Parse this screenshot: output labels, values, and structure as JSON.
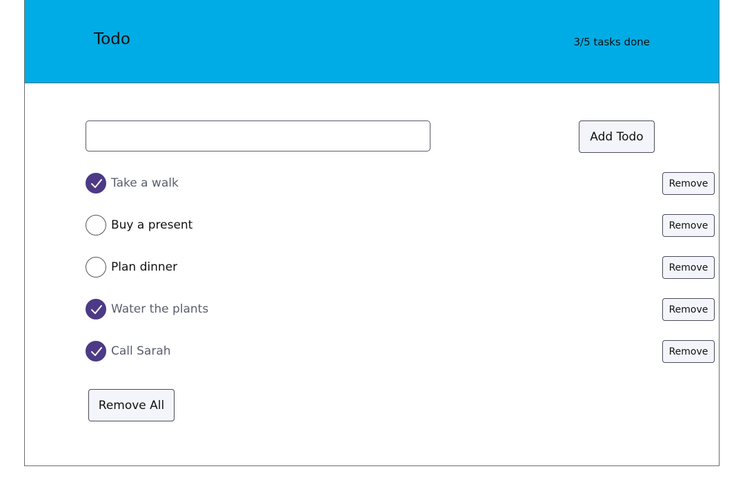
{
  "header": {
    "title": "Todo",
    "progress": "3/5 tasks done",
    "background": "#00ace6"
  },
  "form": {
    "input_value": "",
    "input_placeholder": "",
    "add_label": "Add Todo"
  },
  "todos": [
    {
      "text": "Take a walk",
      "done": true,
      "remove_label": "Remove"
    },
    {
      "text": "Buy a present",
      "done": false,
      "remove_label": "Remove"
    },
    {
      "text": "Plan dinner",
      "done": false,
      "remove_label": "Remove"
    },
    {
      "text": "Water the plants",
      "done": true,
      "remove_label": "Remove"
    },
    {
      "text": "Call Sarah",
      "done": true,
      "remove_label": "Remove"
    }
  ],
  "remove_all_label": "Remove All",
  "colors": {
    "check_done": "#4d3a86",
    "button_bg": "#f4f5fa"
  },
  "icons": {
    "done": "checkmark-icon",
    "open": "empty-circle-icon"
  }
}
